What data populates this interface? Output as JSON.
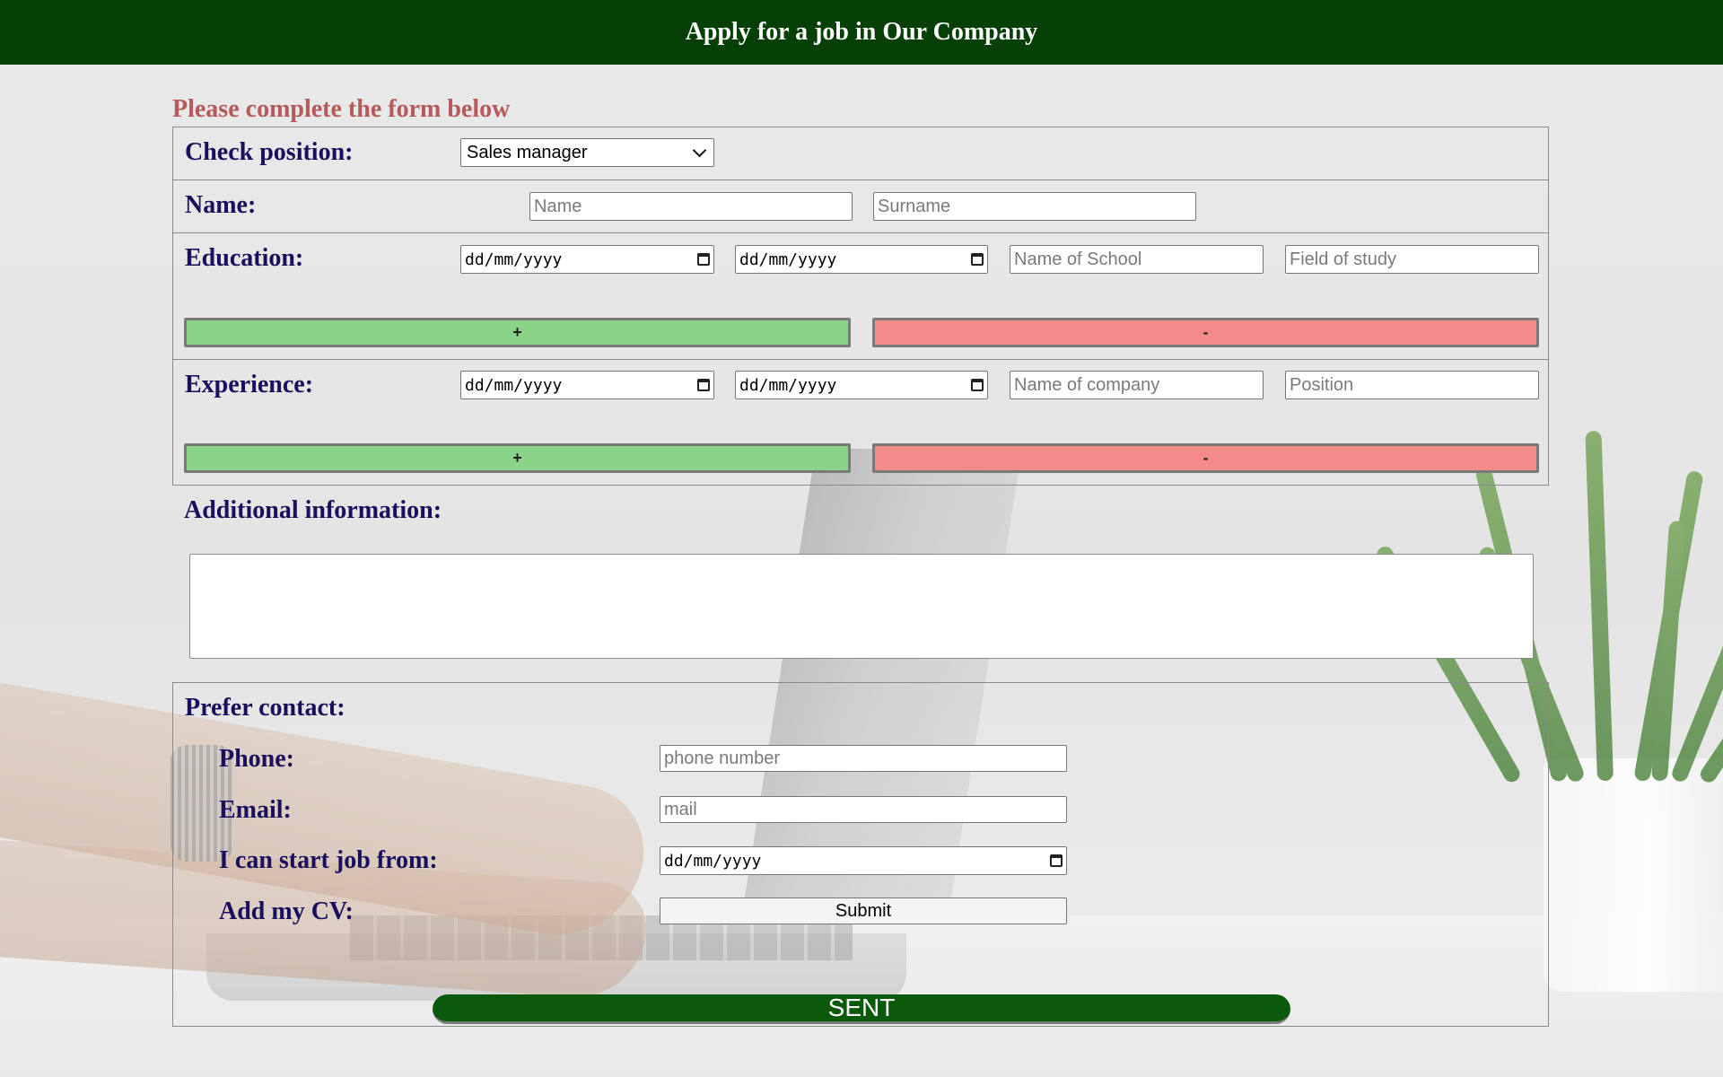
{
  "header": {
    "title": "Apply for a job in Our Company"
  },
  "form": {
    "subtitle": "Please complete the form below",
    "position": {
      "label": "Check position:",
      "selected": "Sales manager"
    },
    "name": {
      "label": "Name:",
      "first_placeholder": "Name",
      "last_placeholder": "Surname"
    },
    "education": {
      "label": "Education:",
      "date_from": "dd/mm/yyyy",
      "date_to": "dd/mm/yyyy",
      "school_placeholder": "Name of School",
      "field_placeholder": "Field of study",
      "add_label": "+",
      "remove_label": "-"
    },
    "experience": {
      "label": "Experience:",
      "date_from": "dd/mm/yyyy",
      "date_to": "dd/mm/yyyy",
      "company_placeholder": "Name of company",
      "position_placeholder": "Position",
      "add_label": "+",
      "remove_label": "-"
    },
    "additional": {
      "label": "Additional information:",
      "value": ""
    },
    "contact": {
      "label": "Prefer contact:",
      "phone_label": "Phone:",
      "phone_placeholder": "phone number",
      "email_label": "Email:",
      "email_placeholder": "mail",
      "start_label": "I can start job from:",
      "start_date": "dd/mm/yyyy",
      "cv_label": "Add my CV:",
      "cv_button": "Submit"
    },
    "sent_button": "SENT"
  },
  "colors": {
    "header_bg": "#064006",
    "label": "#1a0f5c",
    "subtitle": "#b45a5a",
    "add_button": "#8ad48a",
    "remove_button": "#f48b8b",
    "sent_button": "#0b5a0b"
  },
  "icons": {
    "date": "calendar-icon",
    "select": "chevron-down-icon"
  }
}
